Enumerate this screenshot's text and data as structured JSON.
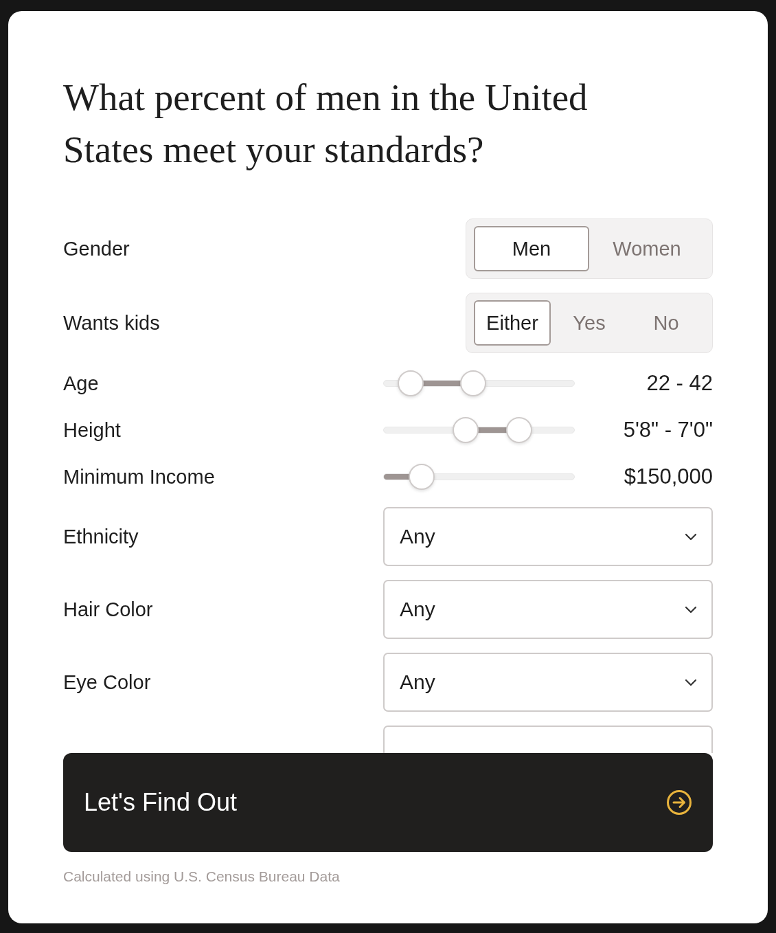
{
  "title": "What percent of men in the United States meet your standards?",
  "fields": [
    {
      "kind": "toggle",
      "label": "Gender",
      "options": [
        {
          "label": "Men",
          "selected": true
        },
        {
          "label": "Women",
          "selected": false
        }
      ]
    },
    {
      "kind": "toggle",
      "label": "Wants kids",
      "options": [
        {
          "label": "Either",
          "selected": true
        },
        {
          "label": "Yes",
          "selected": false
        },
        {
          "label": "No",
          "selected": false
        }
      ]
    },
    {
      "kind": "range",
      "label": "Age",
      "thumbs": [
        {
          "level": 0.14
        },
        {
          "level": 0.47
        }
      ],
      "reading": "22 - 42"
    },
    {
      "kind": "range",
      "label": "Height",
      "thumbs": [
        {
          "level": 0.43
        },
        {
          "level": 0.71
        }
      ],
      "reading": "5'8\" - 7'0\""
    },
    {
      "kind": "slider",
      "label": "Minimum Income",
      "level": 0.2,
      "reading": "$150,000"
    },
    {
      "kind": "select",
      "label": "Ethnicity",
      "value": "Any"
    },
    {
      "kind": "select",
      "label": "Hair Color",
      "value": "Any"
    },
    {
      "kind": "select",
      "label": "Eye Color",
      "value": "Any"
    },
    {
      "kind": "select"
    }
  ],
  "submit": {
    "label": "Let's Find Out"
  },
  "footnote": "Calculated using U.S. Census Bureau Data"
}
